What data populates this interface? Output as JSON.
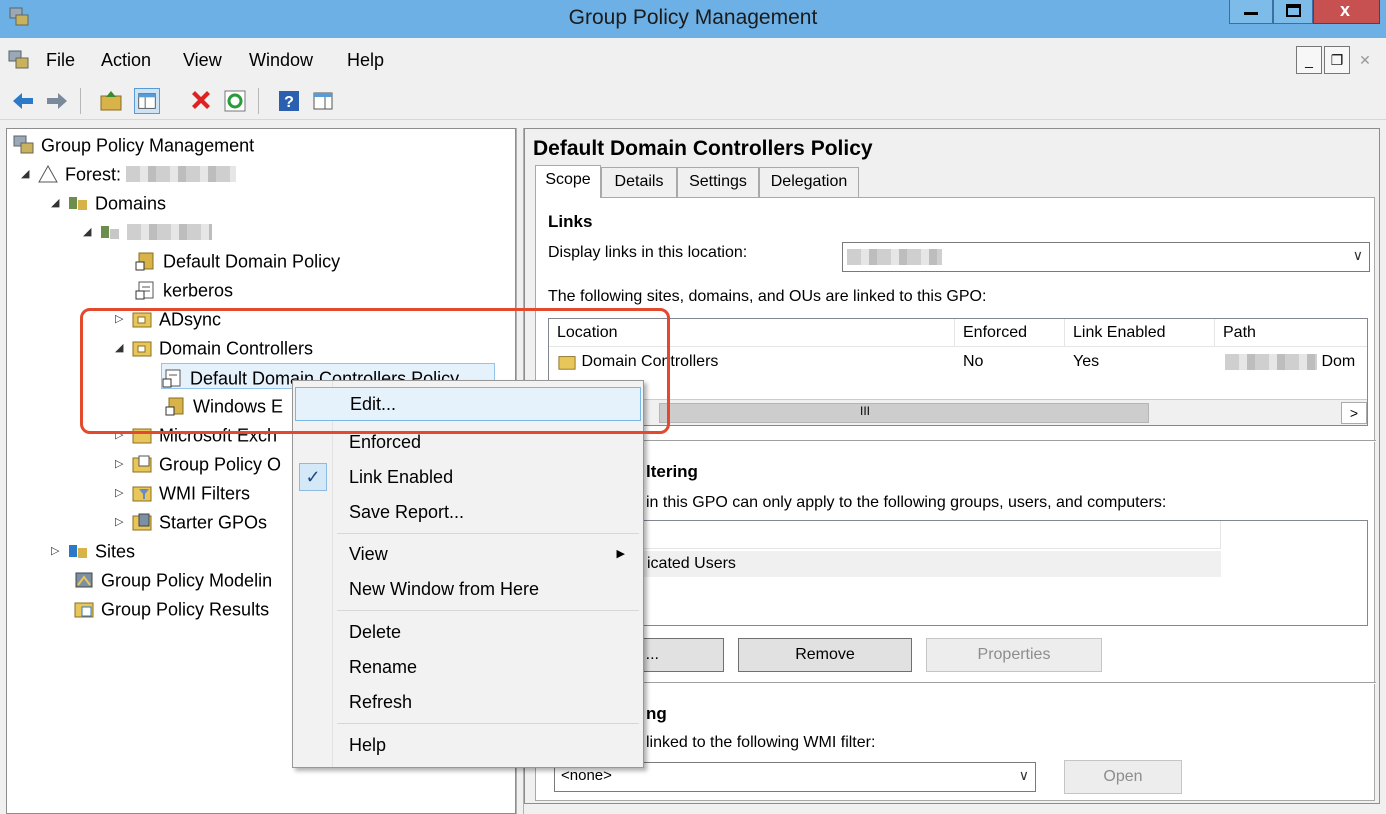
{
  "window": {
    "title": "Group Policy Management"
  },
  "menubar": {
    "items": [
      "File",
      "Action",
      "View",
      "Window",
      "Help"
    ]
  },
  "tree": {
    "root": "Group Policy Management",
    "forest_label": "Forest:",
    "domains": "Domains",
    "default_domain_policy": "Default Domain Policy",
    "kerberos": "kerberos",
    "adsync": "ADsync",
    "domain_controllers": "Domain Controllers",
    "default_dc_policy": "Default Domain Controllers Policy",
    "windows_item": "Windows E",
    "microsoft_exch": "Microsoft Exch",
    "group_policy_objects": "Group Policy O",
    "wmi_filters": "WMI Filters",
    "starter_gpos": "Starter GPOs",
    "sites": "Sites",
    "modeling": "Group Policy Modelin",
    "results": "Group Policy Results"
  },
  "details": {
    "title": "Default Domain Controllers Policy",
    "tabs": [
      "Scope",
      "Details",
      "Settings",
      "Delegation"
    ],
    "links_heading": "Links",
    "display_links_label": "Display links in this location:",
    "linked_label": "The following sites, domains, and OUs are linked to this GPO:",
    "columns": [
      "Location",
      "Enforced",
      "Link Enabled",
      "Path"
    ],
    "row": {
      "location": "Domain Controllers",
      "enforced": "No",
      "link_enabled": "Yes",
      "path": "Dom"
    },
    "scroll_mid": "III",
    "scroll_right": ">",
    "filtering_heading": "ltering",
    "filtering_text": "in this GPO can only apply to the following groups, users, and computers:",
    "filter_row": "icated Users",
    "add_button": "...",
    "remove_button": "Remove",
    "properties_button": "Properties",
    "wmi_heading": "ng",
    "wmi_text": "linked to the following WMI filter:",
    "wmi_value": "<none>",
    "open_button": "Open"
  },
  "context_menu": {
    "edit": "Edit...",
    "enforced": "Enforced",
    "link_enabled": "Link Enabled",
    "save_report": "Save Report...",
    "view": "View",
    "new_window": "New Window from Here",
    "delete": "Delete",
    "rename": "Rename",
    "refresh": "Refresh",
    "help": "Help",
    "check_mark": "✓",
    "submenu_arrow": "▶"
  },
  "colors": {
    "titlebar": "#6cb0e6",
    "highlight": "#e2492d",
    "selection": "#e5f1fb"
  }
}
